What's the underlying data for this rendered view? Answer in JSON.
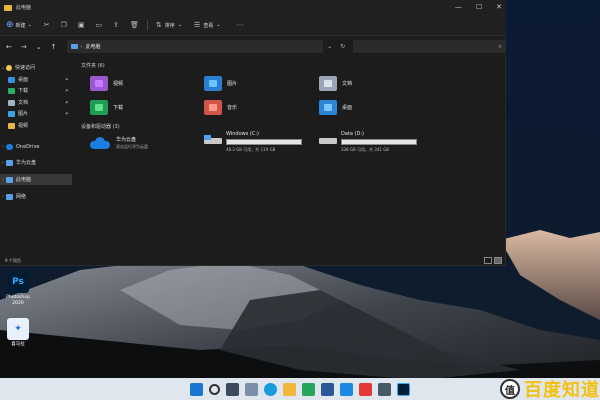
{
  "window": {
    "title": "此电脑",
    "controls": [
      "—",
      "☐",
      "✕"
    ]
  },
  "toolbar": {
    "new_label": "新建",
    "sort_label": "排序",
    "view_label": "查看"
  },
  "address": {
    "path": "此电脑"
  },
  "sidebar": {
    "items": [
      {
        "label": "快速访问",
        "color": "#f2c94c"
      },
      {
        "label": "桌面",
        "color": "#3b8fd8"
      },
      {
        "label": "下载",
        "color": "#27ae60"
      },
      {
        "label": "文档",
        "color": "#a0b4c8"
      },
      {
        "label": "图片",
        "color": "#3aa3e3"
      },
      {
        "label": "视频",
        "color": "#e6b542"
      },
      {
        "label": "OneDrive",
        "color": "#1c7ee0"
      },
      {
        "label": "华为云盘",
        "color": "#5aa0e6"
      },
      {
        "label": "此电脑",
        "color": "#5aa0e6"
      },
      {
        "label": "网络",
        "color": "#5aa0e6"
      }
    ]
  },
  "content": {
    "folders_title": "文件夹 (6)",
    "folders": [
      {
        "label": "视频",
        "color": "#9b59d0",
        "badge": "#c77dff"
      },
      {
        "label": "图片",
        "color": "#2b7fd0",
        "badge": "#6cc3ff"
      },
      {
        "label": "文档",
        "color": "#9aa6b8",
        "badge": "#d8e0ea"
      },
      {
        "label": "下载",
        "color": "#1f9d55",
        "badge": "#5fe08e"
      },
      {
        "label": "音乐",
        "color": "#d0544a",
        "badge": "#ff9a8a"
      },
      {
        "label": "桌面",
        "color": "#2c86d6",
        "badge": "#7cc7ff"
      }
    ],
    "drives_title": "设备和驱动器 (3)",
    "network": {
      "name": "华为云盘",
      "sub": "双击运行华为云盘"
    },
    "drives": [
      {
        "name": "Windows (C:)",
        "free": "48.2 GB 可用，共 119 GB",
        "used_fraction": 0.6
      },
      {
        "name": "Data (D:)",
        "free": "338 GB 可用，共 341 GB",
        "used_fraction": 0.01
      }
    ]
  },
  "status": {
    "count": "9 个项目"
  },
  "desktop": {
    "icons": [
      {
        "label": "Photoshop 2020",
        "glyph": "Ps",
        "bg": "#001d34",
        "fg": "#31a8ff"
      },
      {
        "label": "喜马拉",
        "glyph": "✦",
        "bg": "#e8f1fb",
        "fg": "#1f6fd0"
      }
    ]
  },
  "watermark": {
    "circle": "值",
    "text": "百度知道"
  }
}
